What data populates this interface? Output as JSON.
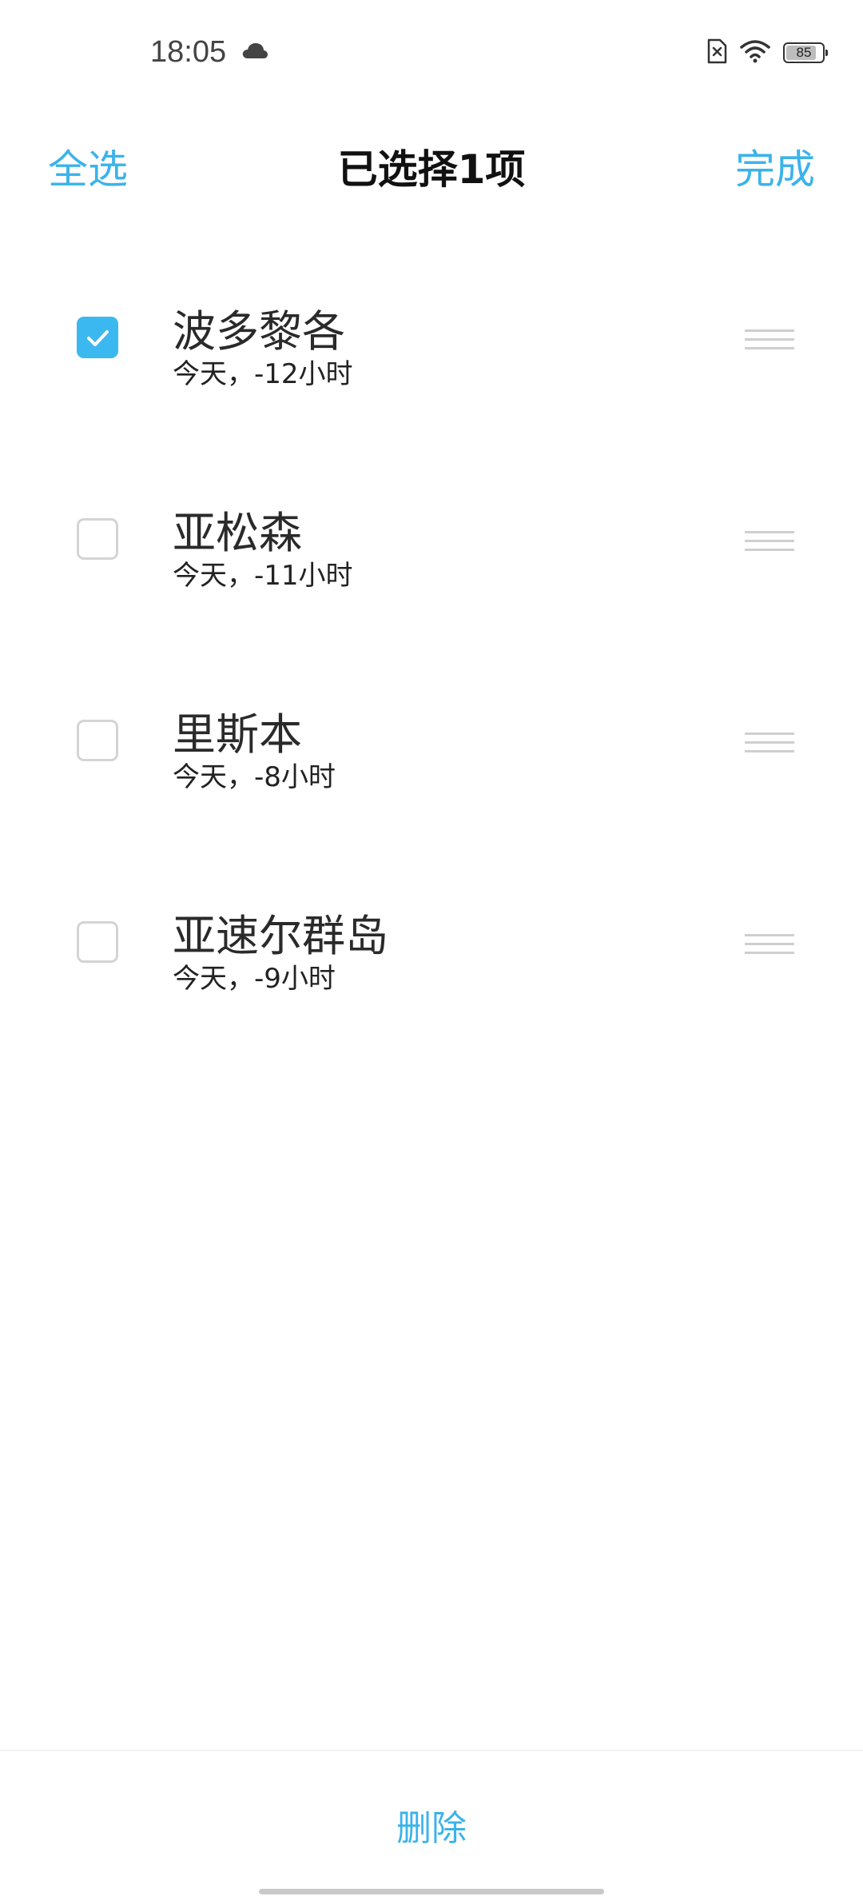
{
  "status_bar": {
    "time": "18:05",
    "battery_level": "85",
    "battery_fraction": 0.85,
    "icons": [
      "cloud-icon",
      "sim-error-icon",
      "wifi-icon",
      "battery-icon"
    ]
  },
  "header": {
    "select_all": "全选",
    "title": "已选择1项",
    "done": "完成"
  },
  "cities": [
    {
      "name": "波多黎各",
      "offset": "今天，-12小时",
      "checked": true
    },
    {
      "name": "亚松森",
      "offset": "今天，-11小时",
      "checked": false
    },
    {
      "name": "里斯本",
      "offset": "今天，-8小时",
      "checked": false
    },
    {
      "name": "亚速尔群岛",
      "offset": "今天，-9小时",
      "checked": false
    }
  ],
  "footer": {
    "delete_label": "删除"
  },
  "colors": {
    "accent": "#3bb3ea",
    "checkbox_checked": "#3cb8f0",
    "checkbox_border": "#d4d4d4"
  }
}
